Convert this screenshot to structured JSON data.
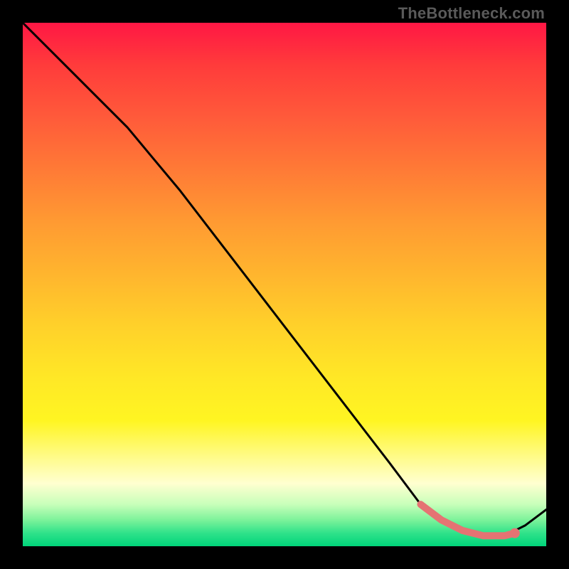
{
  "watermark": "TheBottleneck.com",
  "chart_data": {
    "type": "line",
    "title": "",
    "xlabel": "",
    "ylabel": "",
    "xlim": [
      0,
      100
    ],
    "ylim": [
      0,
      100
    ],
    "grid": false,
    "notes": "Background gradient encodes a qualitative scale from red (top, high value) through orange/yellow to green (bottom, low value). A single black curve descends from top-left toward bottom-right, reaching a minimum near x≈86 then rising slightly. A salmon-colored segment highlights the near-minimum trough region (~x 76–94).",
    "series": [
      {
        "name": "main-curve",
        "color": "#000000",
        "x": [
          0,
          10,
          20,
          25,
          30,
          40,
          50,
          60,
          70,
          76,
          80,
          84,
          88,
          92,
          96,
          100
        ],
        "y": [
          100,
          90,
          80,
          74,
          68,
          55,
          42,
          29,
          16,
          8,
          5,
          3,
          2,
          2,
          4,
          7
        ]
      },
      {
        "name": "trough-highlight",
        "color": "#e57373",
        "x": [
          76,
          80,
          84,
          88,
          92,
          94
        ],
        "y": [
          8,
          5,
          3,
          2,
          2,
          2.5
        ]
      }
    ],
    "points": [
      {
        "name": "highlight-end-dot",
        "x": 94,
        "y": 2.5,
        "color": "#e57373"
      }
    ]
  }
}
